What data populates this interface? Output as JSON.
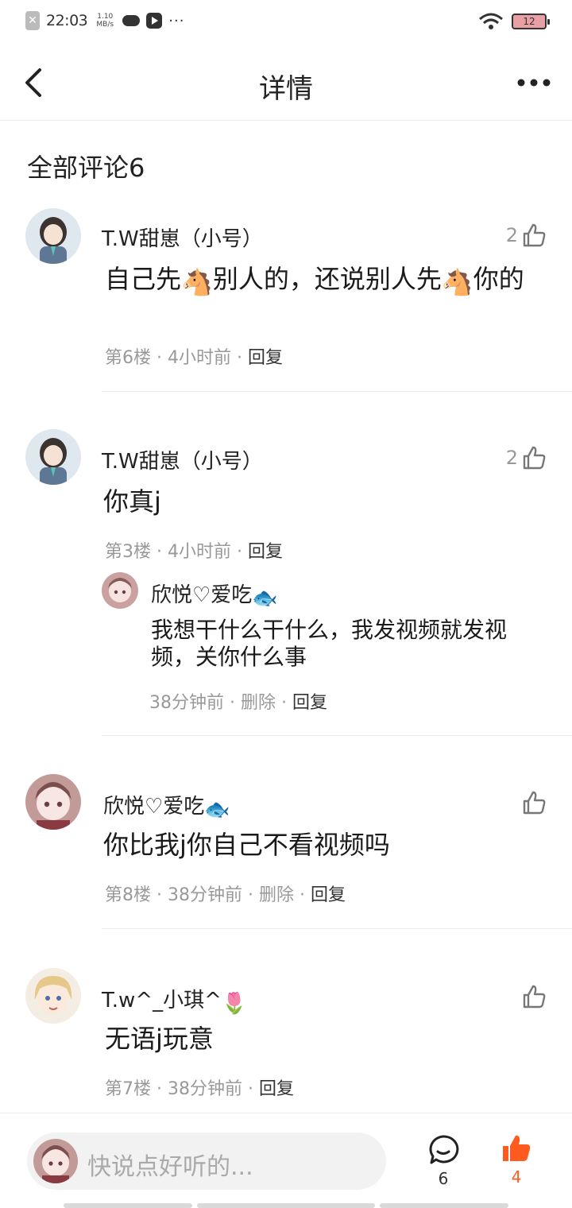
{
  "status_bar": {
    "time": "22:03",
    "speed": "1.10 MB/s",
    "dots": "···",
    "battery": "12"
  },
  "nav": {
    "title": "详情"
  },
  "section_title": "全部评论6",
  "comments": [
    {
      "name": "T.W甜崽（小号）",
      "text_a": "自己先",
      "emoji_1": "🐴",
      "text_b": "别人的，还说别人先",
      "emoji_2": "🐴",
      "text_c": "你的",
      "floor": "第6楼",
      "time": "4小时前",
      "reply": "回复",
      "likes": "2"
    },
    {
      "name": "T.W甜崽（小号）",
      "text": "你真j",
      "floor": "第3楼",
      "time": "4小时前",
      "reply": "回复",
      "likes": "2",
      "sub_reply": {
        "name": "欣悦♡爱吃",
        "name_emoji": "🐟",
        "text": "我想干什么干什么，我发视频就发视频，关你什么事",
        "time": "38分钟前",
        "delete": "删除",
        "reply": "回复"
      }
    },
    {
      "name": "欣悦♡爱吃",
      "name_emoji": "🐟",
      "text": "你比我j你自己不看视频吗",
      "floor": "第8楼",
      "time": "38分钟前",
      "delete": "删除",
      "reply": "回复"
    },
    {
      "name": "T.w^_小琪^",
      "name_emoji": "🌷",
      "text": "无语j玩意",
      "floor": "第7楼",
      "time": "38分钟前",
      "reply": "回复"
    }
  ],
  "bottom_bar": {
    "placeholder": "快说点好听的...",
    "comment_count": "6",
    "like_count": "4",
    "accent_color": "#ff5a1f"
  },
  "meta_separator": " · "
}
